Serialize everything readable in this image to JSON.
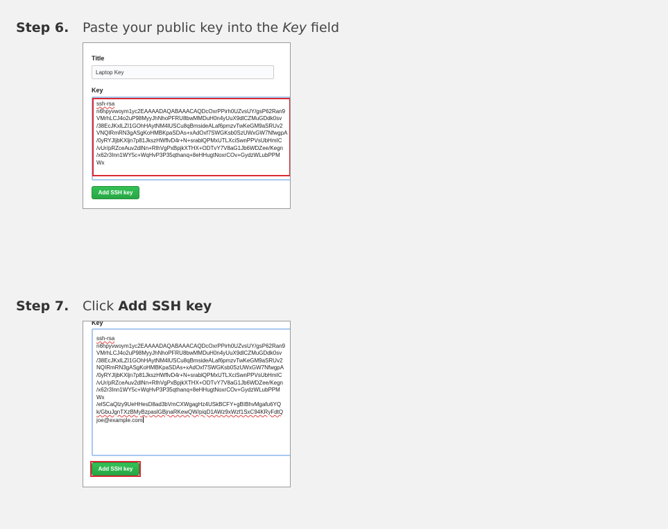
{
  "steps": [
    {
      "label": "Step 6.",
      "text_before": "Paste your public key into the ",
      "text_emphasis": "Key",
      "text_after": " field",
      "screenshot": {
        "title_label": "Title",
        "title_value": "Laptop Key",
        "key_label": "Key",
        "key_lines": [
          "ssh-rsa",
          "n6hpyvwoym1yc2EAAAADAQABAAACAQDcOxrPPirh0UZvsUY/gsP62Ran9",
          "VMrhLCJ4o2uP98MyyJhNhoPFRU8bwMMDuH0n4yUuX9dlCZMuGDdk0sv",
          "/38EcJKxlLZI1GOhHAytNM4lUSCu8qBmsideALaf6pmzvTwKeGM9aSRUv2",
          "VNQIRmRN3gASgKoHMBKpaSDAs+xAdOxf7SWGKsb0SzUWxGW7NfwgpA",
          "/0yRYJljbKXljn7p81JkszHWflvD4r+N+srablQPMxUTLXciSwnPPVsUbHmIC",
          "/vUr/pRZceAuv2dlNn+RlhVgPxBpjkXTHX+ODTvY7V8aG1Jb6WDZee/Kegn",
          "/x62r3Inn1WY5c+WqHvP3P35qthanq+8eHHugtNoxrCOv+GydzWLubPPM",
          "Wx"
        ]
      }
    },
    {
      "label": "Step 7.",
      "text_before": "Click ",
      "text_strong": "Add SSH key",
      "screenshot": {
        "key_label": "Key",
        "key_lines": [
          "ssh-rsa",
          "n6hpyvwoym1yc2EAAAADAQABAAACAQDcOxrPPirh0UZvsUY/gsP62Ran9",
          "VMrhLCJ4o2uP98MyyJhNhoPFRU8bwMMDuH0n4yUuX9dlCZMuGDdk0sv",
          "/38EcJKxlLZI1GOhHAytNM4lUSCu8qBmsideALaf6pmzvTwKeGM9aSRUv2",
          "NQIRmRN3gASgKoHMBKpaSDAs+xAdOxf7SWGKsb0SzUWxGW7NfwgpA",
          "/0yRYJljbKXljn7p81JkszHWflvD4r+N+srablQPMxUTLXciSwnPPVsUbHmIC",
          "/vUr/pRZceAuv2dlNn+RlhVgPxBpjkXTHX+ODTvY7V8aG1Jb6WDZee/Kegn",
          "/x62r3Inn1WY5c+WqHvP3P35qthanq+8eHHugtNoxrCOv+GydzWLubPPM",
          "Wx",
          "/elSCaQlzy9UeHHesD8ad3bVmCXWgagHz4USkBCFY+gBIBhvMgafu6YQ",
          "k/GbuJgnTXzBMyBzpaslGBjnaRKewQW/piqD1AWz9xWzf1SxC94KRyFdtQ",
          "joe@example.com"
        ]
      }
    }
  ],
  "button_label": "Add SSH key",
  "colors": {
    "background": "#f2f2f2",
    "button_green": "#28a745",
    "highlight_red": "#d92a34",
    "focus_blue": "#a8c8f0"
  }
}
